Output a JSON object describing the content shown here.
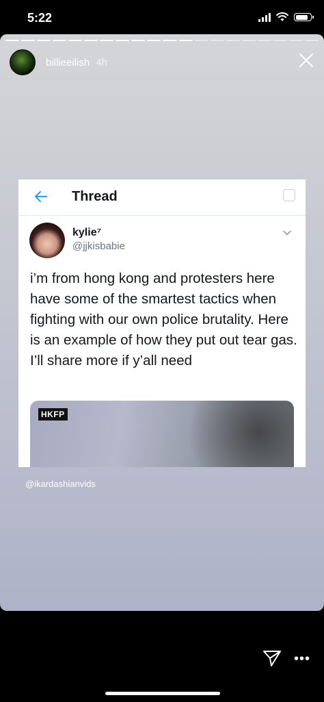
{
  "status_bar": {
    "time": "5:22",
    "battery_level": 0.85
  },
  "story": {
    "username": "billieeilish",
    "time_ago": "4h",
    "segments_total": 20,
    "segments_done": 12,
    "mention": "@ikardashianvids"
  },
  "tweet": {
    "header_title": "Thread",
    "display_name": "kylie⁷",
    "handle": "@jjkisbabie",
    "text": "i’m from hong kong and protesters here have some of the smartest tactics when fighting with our own police brutality. Here is an example of how they put out tear gas. I’ll share more if y’all need",
    "media_watermark": "HKFP"
  },
  "icons": {
    "close": "close-icon",
    "back": "back-arrow-icon",
    "chevron": "chevron-down-icon",
    "send": "send-icon",
    "more": "more-icon",
    "signal": "signal-icon",
    "wifi": "wifi-icon",
    "battery": "battery-icon"
  },
  "colors": {
    "link_blue": "#1da1f2",
    "story_bg_top": "#d4d5d8",
    "story_bg_bottom": "#aeb2c8"
  }
}
